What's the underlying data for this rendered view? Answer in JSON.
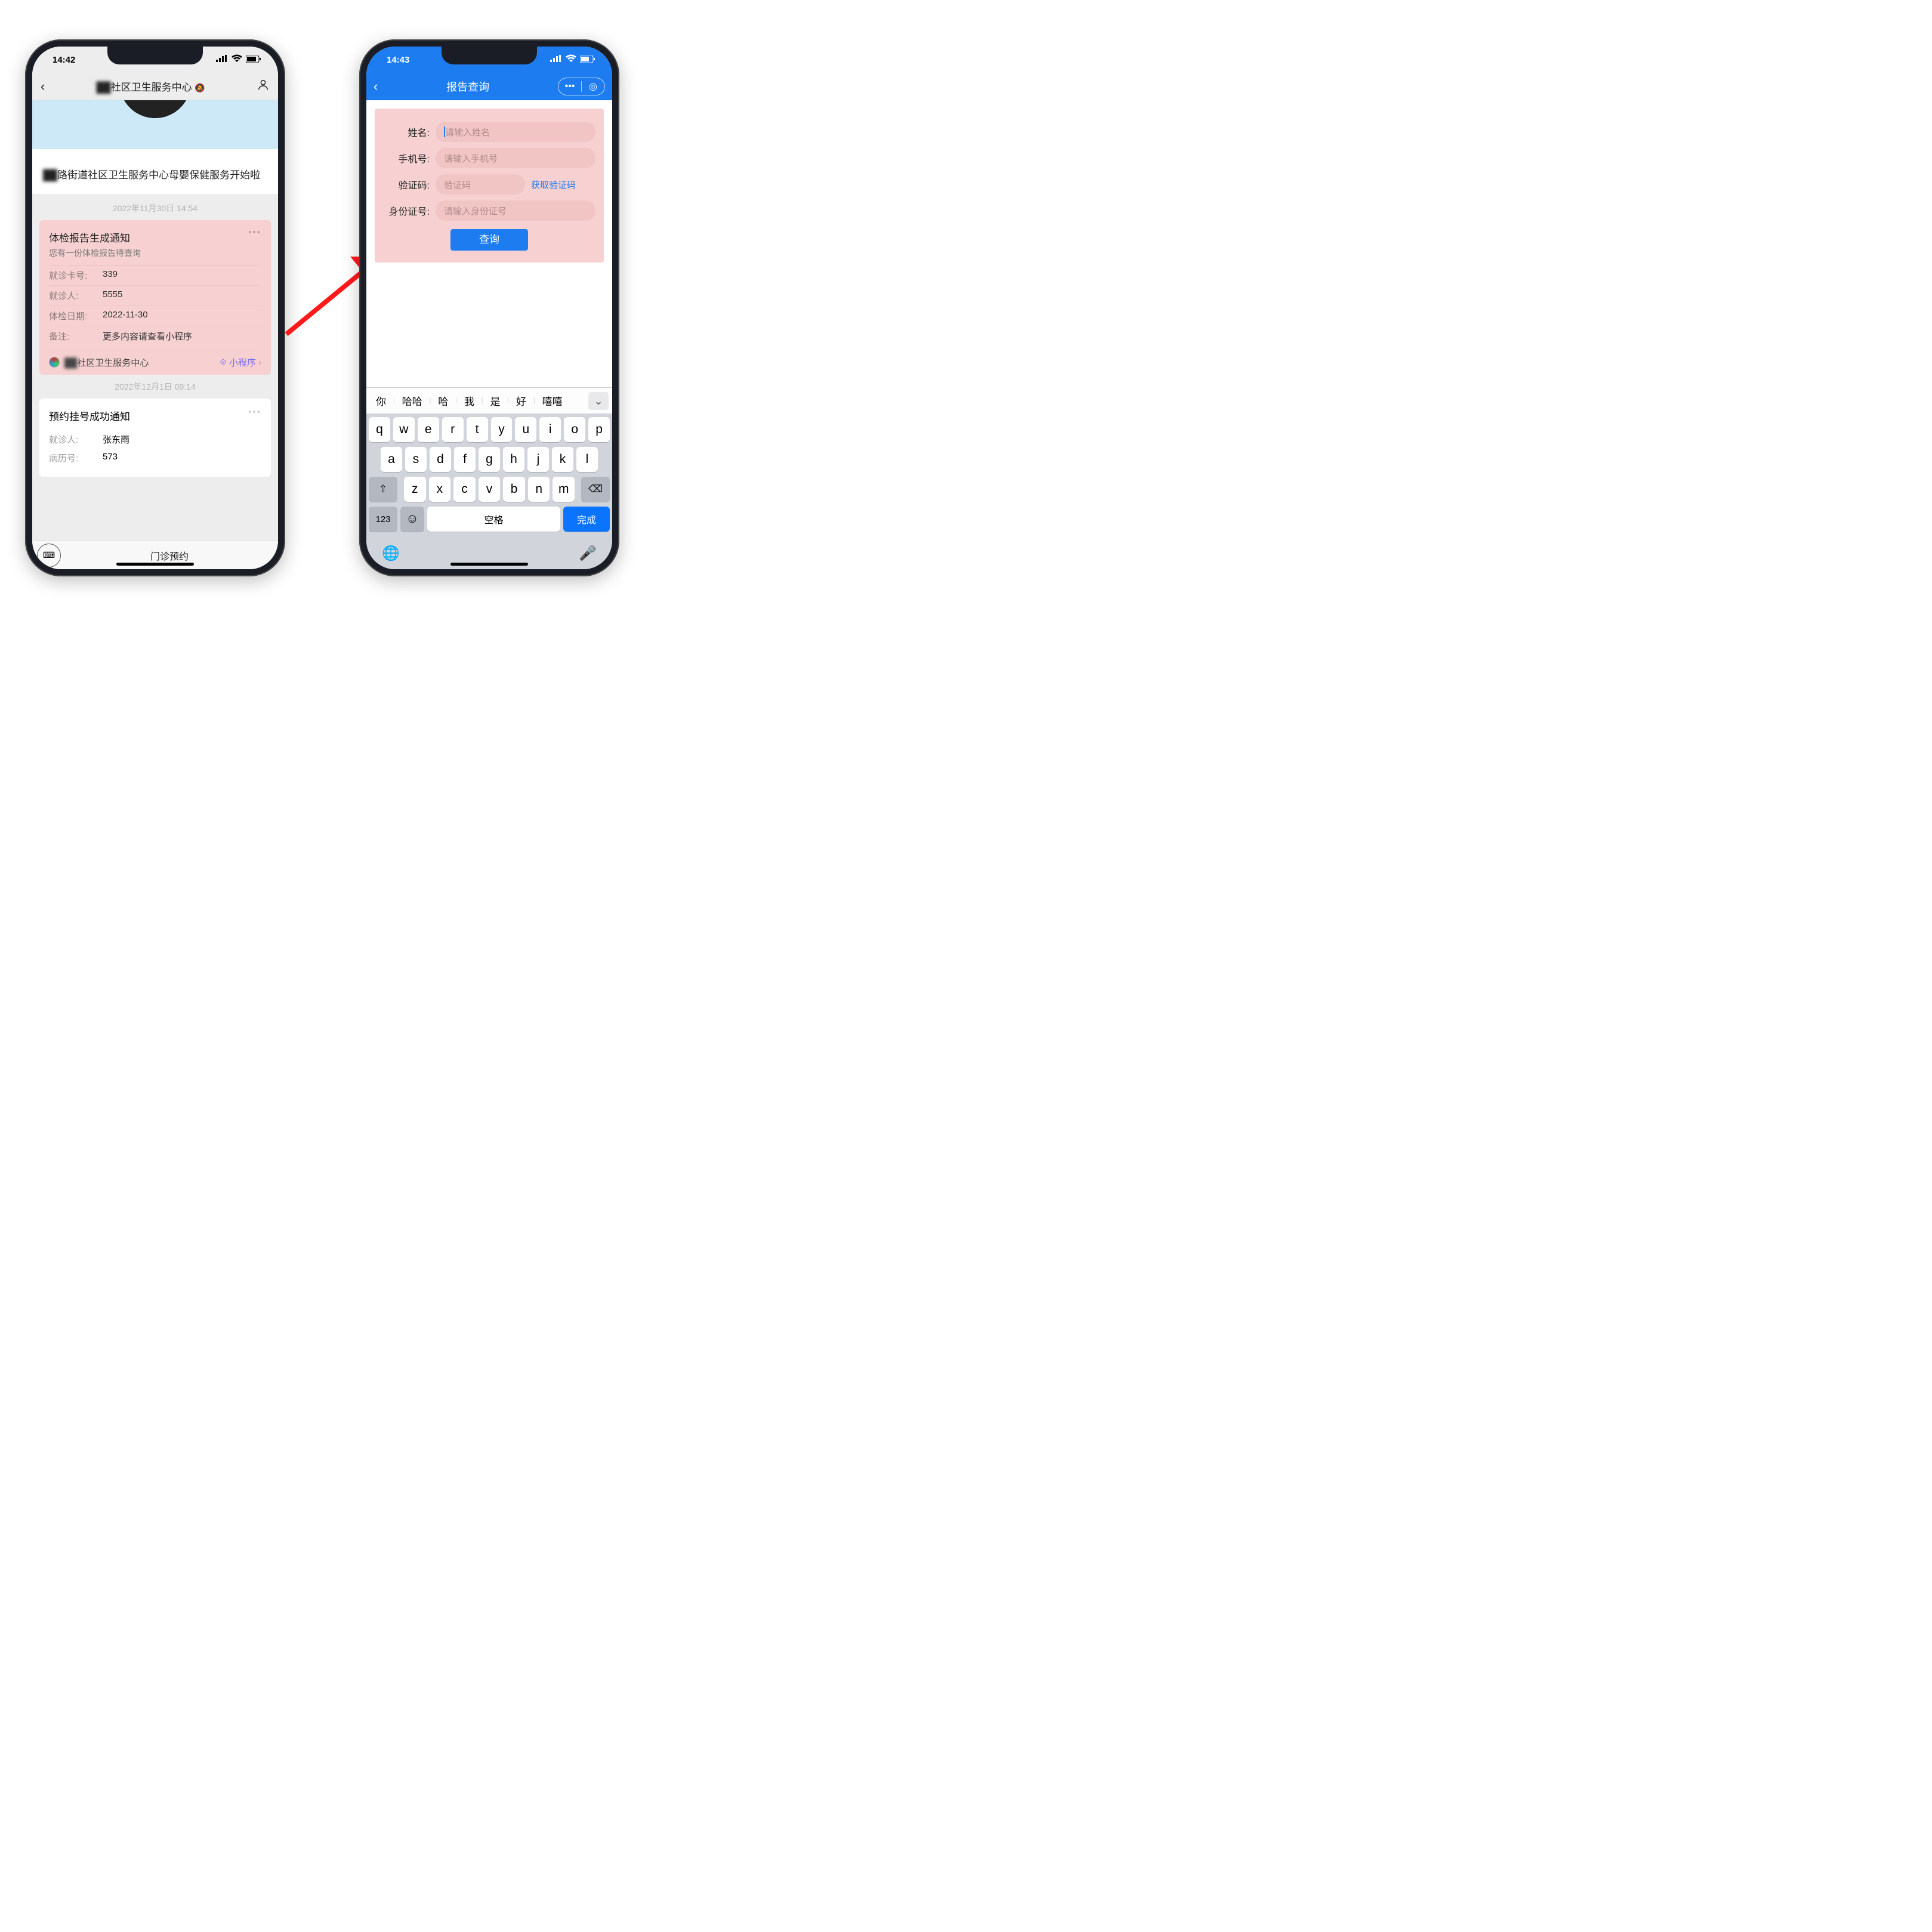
{
  "left": {
    "status": {
      "time": "14:42"
    },
    "nav": {
      "title_suffix": "社区卫生服务中心"
    },
    "news": {
      "text_prefix": "路街道社区卫生服务中心母婴保健服务开始啦"
    },
    "ts1": "2022年11月30日 14:54",
    "report": {
      "title": "体检报告生成通知",
      "sub": "您有一份体检报告待查询",
      "rows": [
        {
          "lbl": "就诊卡号:",
          "val": "339"
        },
        {
          "lbl": "就诊人:",
          "val": "5555"
        },
        {
          "lbl": "体检日期:",
          "val": "2022-11-30"
        },
        {
          "lbl": "备注:",
          "val": "更多内容请查看小程序"
        }
      ],
      "foot_org_suffix": "社区卫生服务中心",
      "foot_mini": "小程序"
    },
    "ts2": "2022年12月1日 09:14",
    "card2": {
      "title": "预约挂号成功通知",
      "rows": [
        {
          "lbl": "就诊人:",
          "val": "张东雨"
        },
        {
          "lbl": "病历号:",
          "val": "573"
        }
      ]
    },
    "bottom": "门诊预约"
  },
  "right": {
    "status": {
      "time": "14:43"
    },
    "nav": {
      "title": "报告查询"
    },
    "form": {
      "name": {
        "lbl": "姓名:",
        "ph": "请输入姓名"
      },
      "phone": {
        "lbl": "手机号:",
        "ph": "请输入手机号"
      },
      "code": {
        "lbl": "验证码:",
        "ph": "验证码",
        "btn": "获取验证码"
      },
      "id": {
        "lbl": "身份证号:",
        "ph": "请输入身份证号"
      },
      "submit": "查询"
    },
    "sugg": [
      "你",
      "哈哈",
      "哈",
      "我",
      "是",
      "好",
      "嘻嘻"
    ],
    "keys": {
      "r1": [
        "q",
        "w",
        "e",
        "r",
        "t",
        "y",
        "u",
        "i",
        "o",
        "p"
      ],
      "r2": [
        "a",
        "s",
        "d",
        "f",
        "g",
        "h",
        "j",
        "k",
        "l"
      ],
      "r3": [
        "z",
        "x",
        "c",
        "v",
        "b",
        "n",
        "m"
      ],
      "n123": "123",
      "space": "空格",
      "done": "完成"
    }
  }
}
